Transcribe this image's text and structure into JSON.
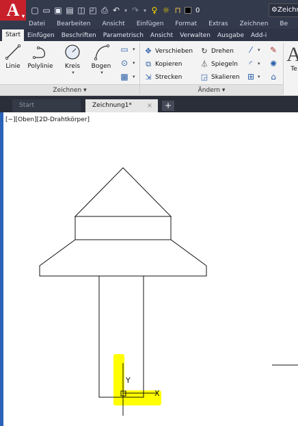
{
  "app": {
    "logo_letter": "A"
  },
  "quick_access": {
    "icons": [
      "new-file",
      "open-file",
      "save",
      "save-as",
      "plot",
      "print",
      "undo",
      "redo",
      "layer-bulb",
      "layer-sun",
      "layer-lock",
      "layer-color"
    ],
    "layer_value": "0",
    "workspace_label": "Zeichnen"
  },
  "menu": [
    "Datei",
    "Bearbeiten",
    "Ansicht",
    "Einfügen",
    "Format",
    "Extras",
    "Zeichnen",
    "Be"
  ],
  "ribbon_tabs": [
    "Start",
    "Einfügen",
    "Beschriften",
    "Parametrisch",
    "Ansicht",
    "Verwalten",
    "Ausgabe",
    "Add-i"
  ],
  "ribbon": {
    "draw_tools": [
      {
        "label": "Linie"
      },
      {
        "label": "Polylinie"
      },
      {
        "label": "Kreis"
      },
      {
        "label": "Bogen"
      }
    ],
    "draw_panel_title": "Zeichnen ▾",
    "modify_tools": [
      {
        "label": "Verschieben",
        "icon": "move"
      },
      {
        "label": "Drehen",
        "icon": "rotate"
      },
      {
        "label": "Kopieren",
        "icon": "copy"
      },
      {
        "label": "Spiegeln",
        "icon": "mirror"
      },
      {
        "label": "Strecken",
        "icon": "stretch"
      },
      {
        "label": "Skalieren",
        "icon": "scale"
      }
    ],
    "modify_panel_title": "Ändern ▾",
    "text_label": "Te"
  },
  "doc_tabs": {
    "start": "Start",
    "active": "Zeichnung1*",
    "close": "×",
    "add": "+"
  },
  "viewport_label": "[−][Oben][2D-Drahtkörper]",
  "ucs": {
    "y_label": "Y",
    "x_label": "X"
  },
  "colors": {
    "highlight": "#ffff00",
    "canvas_border": "#2a63b8",
    "app_red": "#c8202b"
  }
}
